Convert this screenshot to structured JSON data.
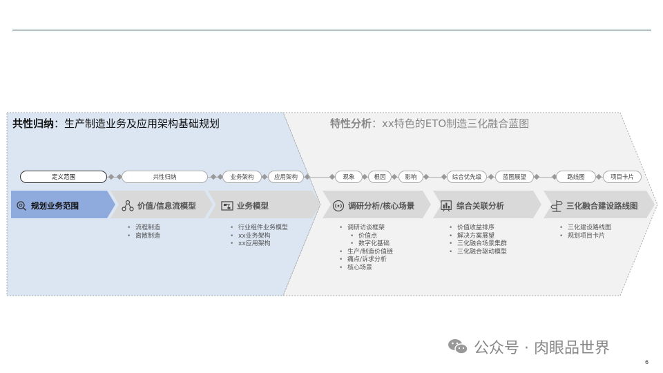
{
  "left_header": {
    "bold": "共性归纳",
    "rest": "：生产制造业务及应用架构基础规划"
  },
  "right_header": {
    "bold": "特性分析",
    "rest": "：xx特色的ETO制造三化融合蓝图"
  },
  "pills": [
    "定义范围",
    "共性归纳",
    "业务架构",
    "应用架构",
    "现象",
    "根因",
    "影响",
    "综合优先级",
    "蓝图展望",
    "路线图",
    "项目卡片"
  ],
  "chevrons": [
    {
      "label": "规划业务范围",
      "icon": "search-gear-icon"
    },
    {
      "label": "价值/信息流模型",
      "icon": "network-nodes-icon"
    },
    {
      "label": "业务模型",
      "icon": "org-chart-icon"
    },
    {
      "label": "调研分析/核心场景",
      "icon": "broadcast-icon"
    },
    {
      "label": "综合关联分析",
      "icon": "analysis-chart-icon"
    },
    {
      "label": "三化融合建设路线图",
      "icon": "road-sign-icon"
    }
  ],
  "lists": {
    "value_flow": [
      "流程制造",
      "离散制造"
    ],
    "business_model": [
      "行业组件业务模型",
      "xx业务架构",
      "xx应用架构"
    ],
    "research": [
      "调研访谈框架",
      "价值点",
      "数字化基础",
      "生产/制造价值链",
      "痛点/诉求分析",
      "核心场景"
    ],
    "correlation": [
      "价值收益排序",
      "解决方案展望",
      "三化融合场景集群",
      "三化融合驱动模型"
    ],
    "roadmap": [
      "三化建设路线图",
      "规划项目卡片"
    ]
  },
  "watermark": "公众号 · 肉眼品世界",
  "page_number": "6",
  "colors": {
    "left_panel": "#dce6f3",
    "right_panel": "#f2f2f2",
    "chevron_first": "#8faadc",
    "chevron_other": "#d9d9d9"
  }
}
